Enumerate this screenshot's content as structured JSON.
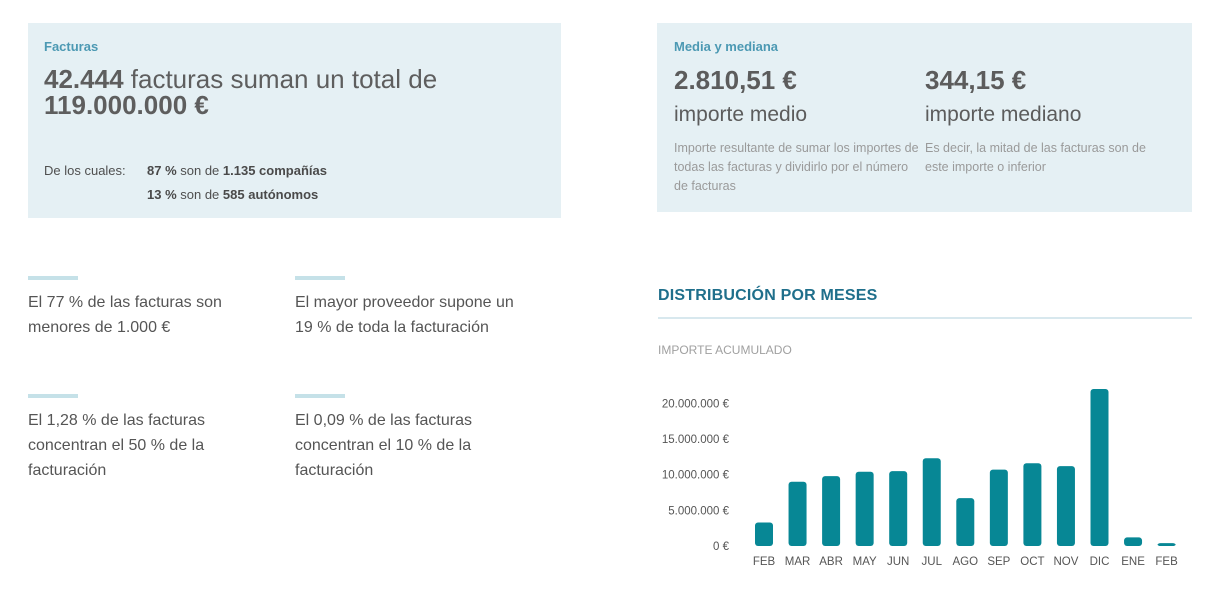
{
  "invoices": {
    "label": "Facturas",
    "count": "42.444",
    "headline_text": " facturas suman un total de",
    "total": "119.000.000 €",
    "breakdown_prefix": "De los cuales:",
    "companies_pct": "87 %",
    "companies_mid": " son de ",
    "companies_count": "1.135 compañías",
    "freelancers_pct": "13 %",
    "freelancers_mid": " son de ",
    "freelancers_count": "585 autónomos"
  },
  "stats": {
    "label": "Media y mediana",
    "mean_value": "2.810,51 €",
    "mean_caption": "importe medio",
    "mean_desc": "Importe resultante de sumar los importes de todas las facturas y dividirlo por el número de facturas",
    "median_value": "344,15 €",
    "median_caption": "importe mediano",
    "median_desc": "Es decir, la mitad de las facturas son de este importe o inferior"
  },
  "facts": [
    "El 77 % de las facturas son menores de 1.000 €",
    "El mayor proveedor supone un 19 % de toda la facturación",
    "El 1,28 % de las facturas concentran el 50 % de la facturación",
    "El 0,09 % de las facturas concentran el 10 % de la facturación"
  ],
  "chart_data": {
    "type": "bar",
    "title": "DISTRIBUCIÓN POR MESES",
    "ylabel": "IMPORTE ACUMULADO",
    "categories": [
      "FEB",
      "MAR",
      "ABR",
      "MAY",
      "JUN",
      "JUL",
      "AGO",
      "SEP",
      "OCT",
      "NOV",
      "DIC",
      "ENE",
      "FEB"
    ],
    "values": [
      3300000,
      9000000,
      9800000,
      10400000,
      10500000,
      12300000,
      6700000,
      10700000,
      11600000,
      11200000,
      22000000,
      1200000,
      400000
    ],
    "ylim": [
      0,
      22000000
    ],
    "yticks": [
      0,
      5000000,
      10000000,
      15000000,
      20000000
    ],
    "ytick_labels": [
      "0 €",
      "5.000.000 €",
      "10.000.000 €",
      "15.000.000 €",
      "20.000.000 €"
    ],
    "grid": false,
    "bar_color": "#078795"
  }
}
